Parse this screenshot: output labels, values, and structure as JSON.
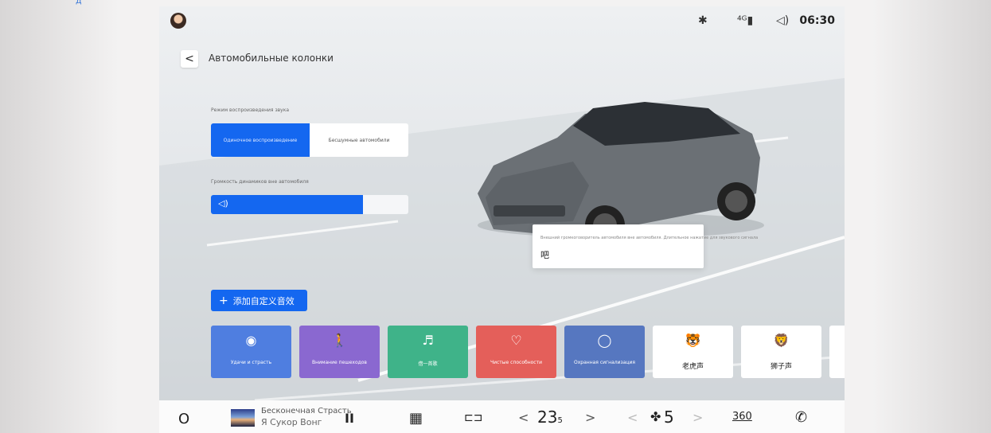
{
  "topline": {
    "text": "д"
  },
  "status": {
    "bluetooth_icon": "bluetooth-icon",
    "signal_icon": "signal-icon",
    "volume_icon": "volume-icon",
    "time": "06:30"
  },
  "header": {
    "back_label": "<",
    "title": "Автомобильные колонки"
  },
  "playback": {
    "section_label": "Режим воспроизведения звука",
    "options": [
      "Одиночное воспроизведение",
      "Бесшумные автомобили"
    ],
    "selected_index": 0
  },
  "volume": {
    "section_label": "Громкость динамиков вне автомобиля",
    "icon_glyph": "◁)",
    "level_percent": 77
  },
  "tooltip": {
    "text": "Внешний громкоговоритель автомобиля вне автомобиля. Длительное нажатие для звукового сигнала",
    "value": "吧"
  },
  "add_button": {
    "plus": "+",
    "label": "添加自定义音效"
  },
  "sound_cards": [
    {
      "icon": "speech-bubble-icon",
      "glyph": "◉",
      "label": "Удачи и страсть",
      "color": "#4f7ee0"
    },
    {
      "icon": "walking-person-icon",
      "glyph": "🚶",
      "label": "Внимание пешеходов",
      "color": "#8a68d0"
    },
    {
      "icon": "music-icon",
      "glyph": "♬",
      "label": "借一首歌",
      "color": "#3fb389"
    },
    {
      "icon": "heart-icon",
      "glyph": "♡",
      "label": "Чистые способности",
      "color": "#e45f5a"
    },
    {
      "icon": "shield-check-icon",
      "glyph": "◯",
      "label": "Охранная сигнализация",
      "color": "#5677c0"
    },
    {
      "icon": "tiger-icon",
      "glyph": "🐯",
      "label": "老虎声",
      "color": "#ffffff"
    },
    {
      "icon": "lion-icon",
      "glyph": "🦁",
      "label": "狮子声",
      "color": "#ffffff"
    }
  ],
  "dock": {
    "home_glyph": "O",
    "song_title": "Бесконечная Страсть",
    "artist": "Я Сукор Вонг",
    "pause_glyph": "II",
    "apps_glyph": "▦",
    "car_glyph": "⊏⊐",
    "temp": "23",
    "temp_decimal": "5",
    "left_chevron": "<",
    "right_chevron": ">",
    "fan_glyph": "✤",
    "fan_level": "5",
    "view360": "360",
    "phone_glyph": "✆"
  }
}
